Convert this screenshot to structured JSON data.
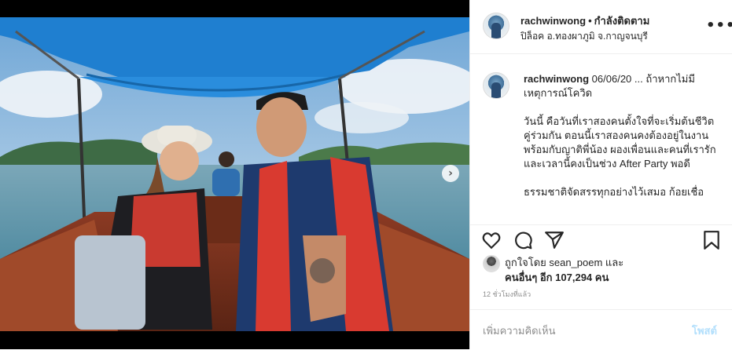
{
  "header": {
    "username": "rachwinwong",
    "separator": "•",
    "follow_status": "กำลังติดตาม",
    "location": "ปิล็อค อ.ทองผาภูมิ จ.กาญจนบุรี",
    "more_label": "•••"
  },
  "caption": {
    "username": "rachwinwong",
    "text": " 06/06/20 ... ถ้าหากไม่มีเหตุการณ์โควิด\n\nวันนี้ คือวันที่เราสองคนตั้งใจที่จะเริ่มต้นชีวิตคู่ร่วมกัน ตอนนี้เราสองคนคงต้องอยู่ในงานพร้อมกับญาติพี่น้อง ผองเพื่อนและคนที่เรารัก และเวลานี้คงเป็นช่วง After Party พอดี\n\nธรรมชาติจัดสรรทุกอย่างไว้เสมอ ก้อยเชื่อ"
  },
  "photo": {
    "next_icon": "chevron-right-icon",
    "next_label": "›"
  },
  "actions": {
    "like_icon": "heart-icon",
    "comment_icon": "comment-icon",
    "share_icon": "paper-plane-icon",
    "save_icon": "bookmark-icon"
  },
  "likes": {
    "line1": "ถูกใจโดย sean_poem และ",
    "line2": "คนอื่นๆ อีก 107,294 คน"
  },
  "timestamp": "12 ชั่วโมงที่แล้ว",
  "comment": {
    "placeholder": "เพิ่มความคิดเห็น",
    "post_label": "โพสต์"
  },
  "colors": {
    "post_button": "#b2dffc",
    "canopy": "#1f7fd0",
    "life_vest": "#d93a30"
  }
}
